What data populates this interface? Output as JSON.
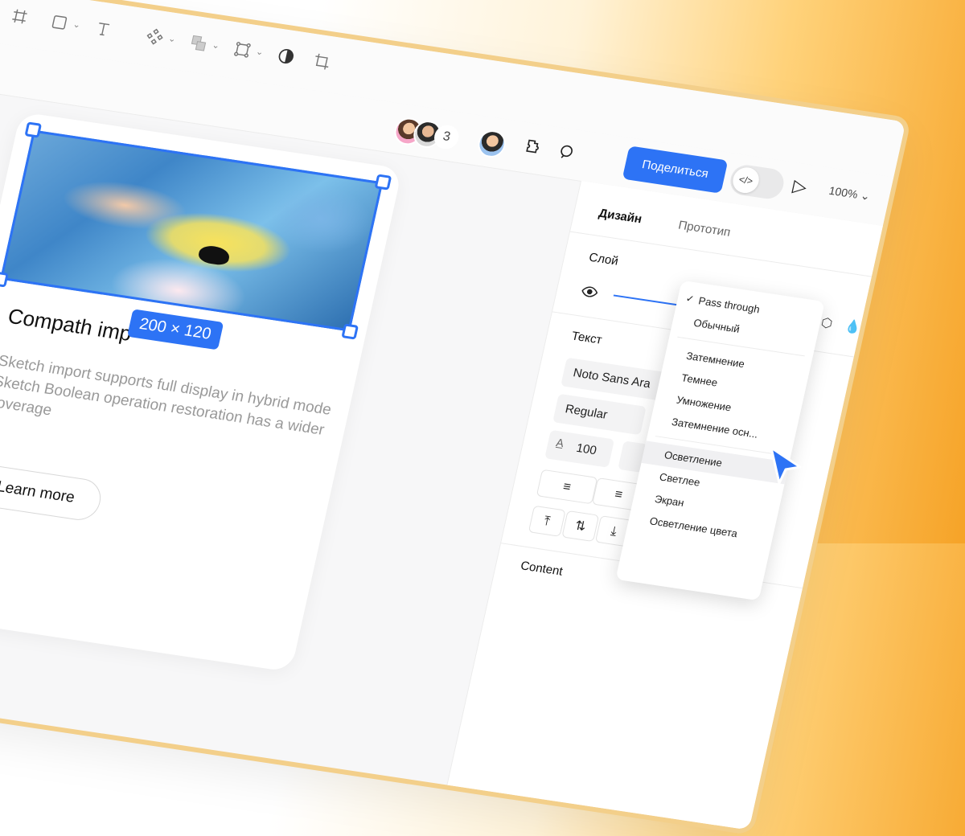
{
  "toolbar": {
    "tools": [
      "frame-icon",
      "rectangle-icon",
      "text-icon",
      "component-icon",
      "boolean-icon",
      "path-icon",
      "contrast-icon",
      "crop-icon"
    ]
  },
  "header": {
    "collaborators_count": "3",
    "share_label": "Поделиться",
    "code_icon": "</>",
    "zoom": "100%"
  },
  "canvas": {
    "card": {
      "title": "Compath imp",
      "dimension_label": "200 × 120",
      "description": "Sketch import supports full display in hybrid mode Sketch Boolean operation restoration has a wider coverage",
      "button_label": "Learn more"
    }
  },
  "panel": {
    "tabs": [
      {
        "label": "Дизайн",
        "active": true
      },
      {
        "label": "Прототип",
        "active": false
      }
    ],
    "layer_section": "Слой",
    "text_section": "Текст",
    "font_family": "Noto Sans Ara",
    "font_weight": "Regular",
    "font_size": "100",
    "content_section": "Content"
  },
  "blend_menu": {
    "items": [
      {
        "label": "Pass through",
        "checked": true
      },
      {
        "label": "Обычный"
      },
      {
        "label": "Затемнение"
      },
      {
        "label": "Темнее"
      },
      {
        "label": "Умножение"
      },
      {
        "label": "Затемнение осн..."
      },
      {
        "label": "Осветление",
        "hovered": true
      },
      {
        "label": "Светлее"
      },
      {
        "label": "Экран"
      },
      {
        "label": "Осветление цвета"
      }
    ]
  },
  "colors": {
    "accent": "#2d73f5",
    "frame_border": "#f3cf8a",
    "bg_gradient_end": "#f6a327"
  }
}
